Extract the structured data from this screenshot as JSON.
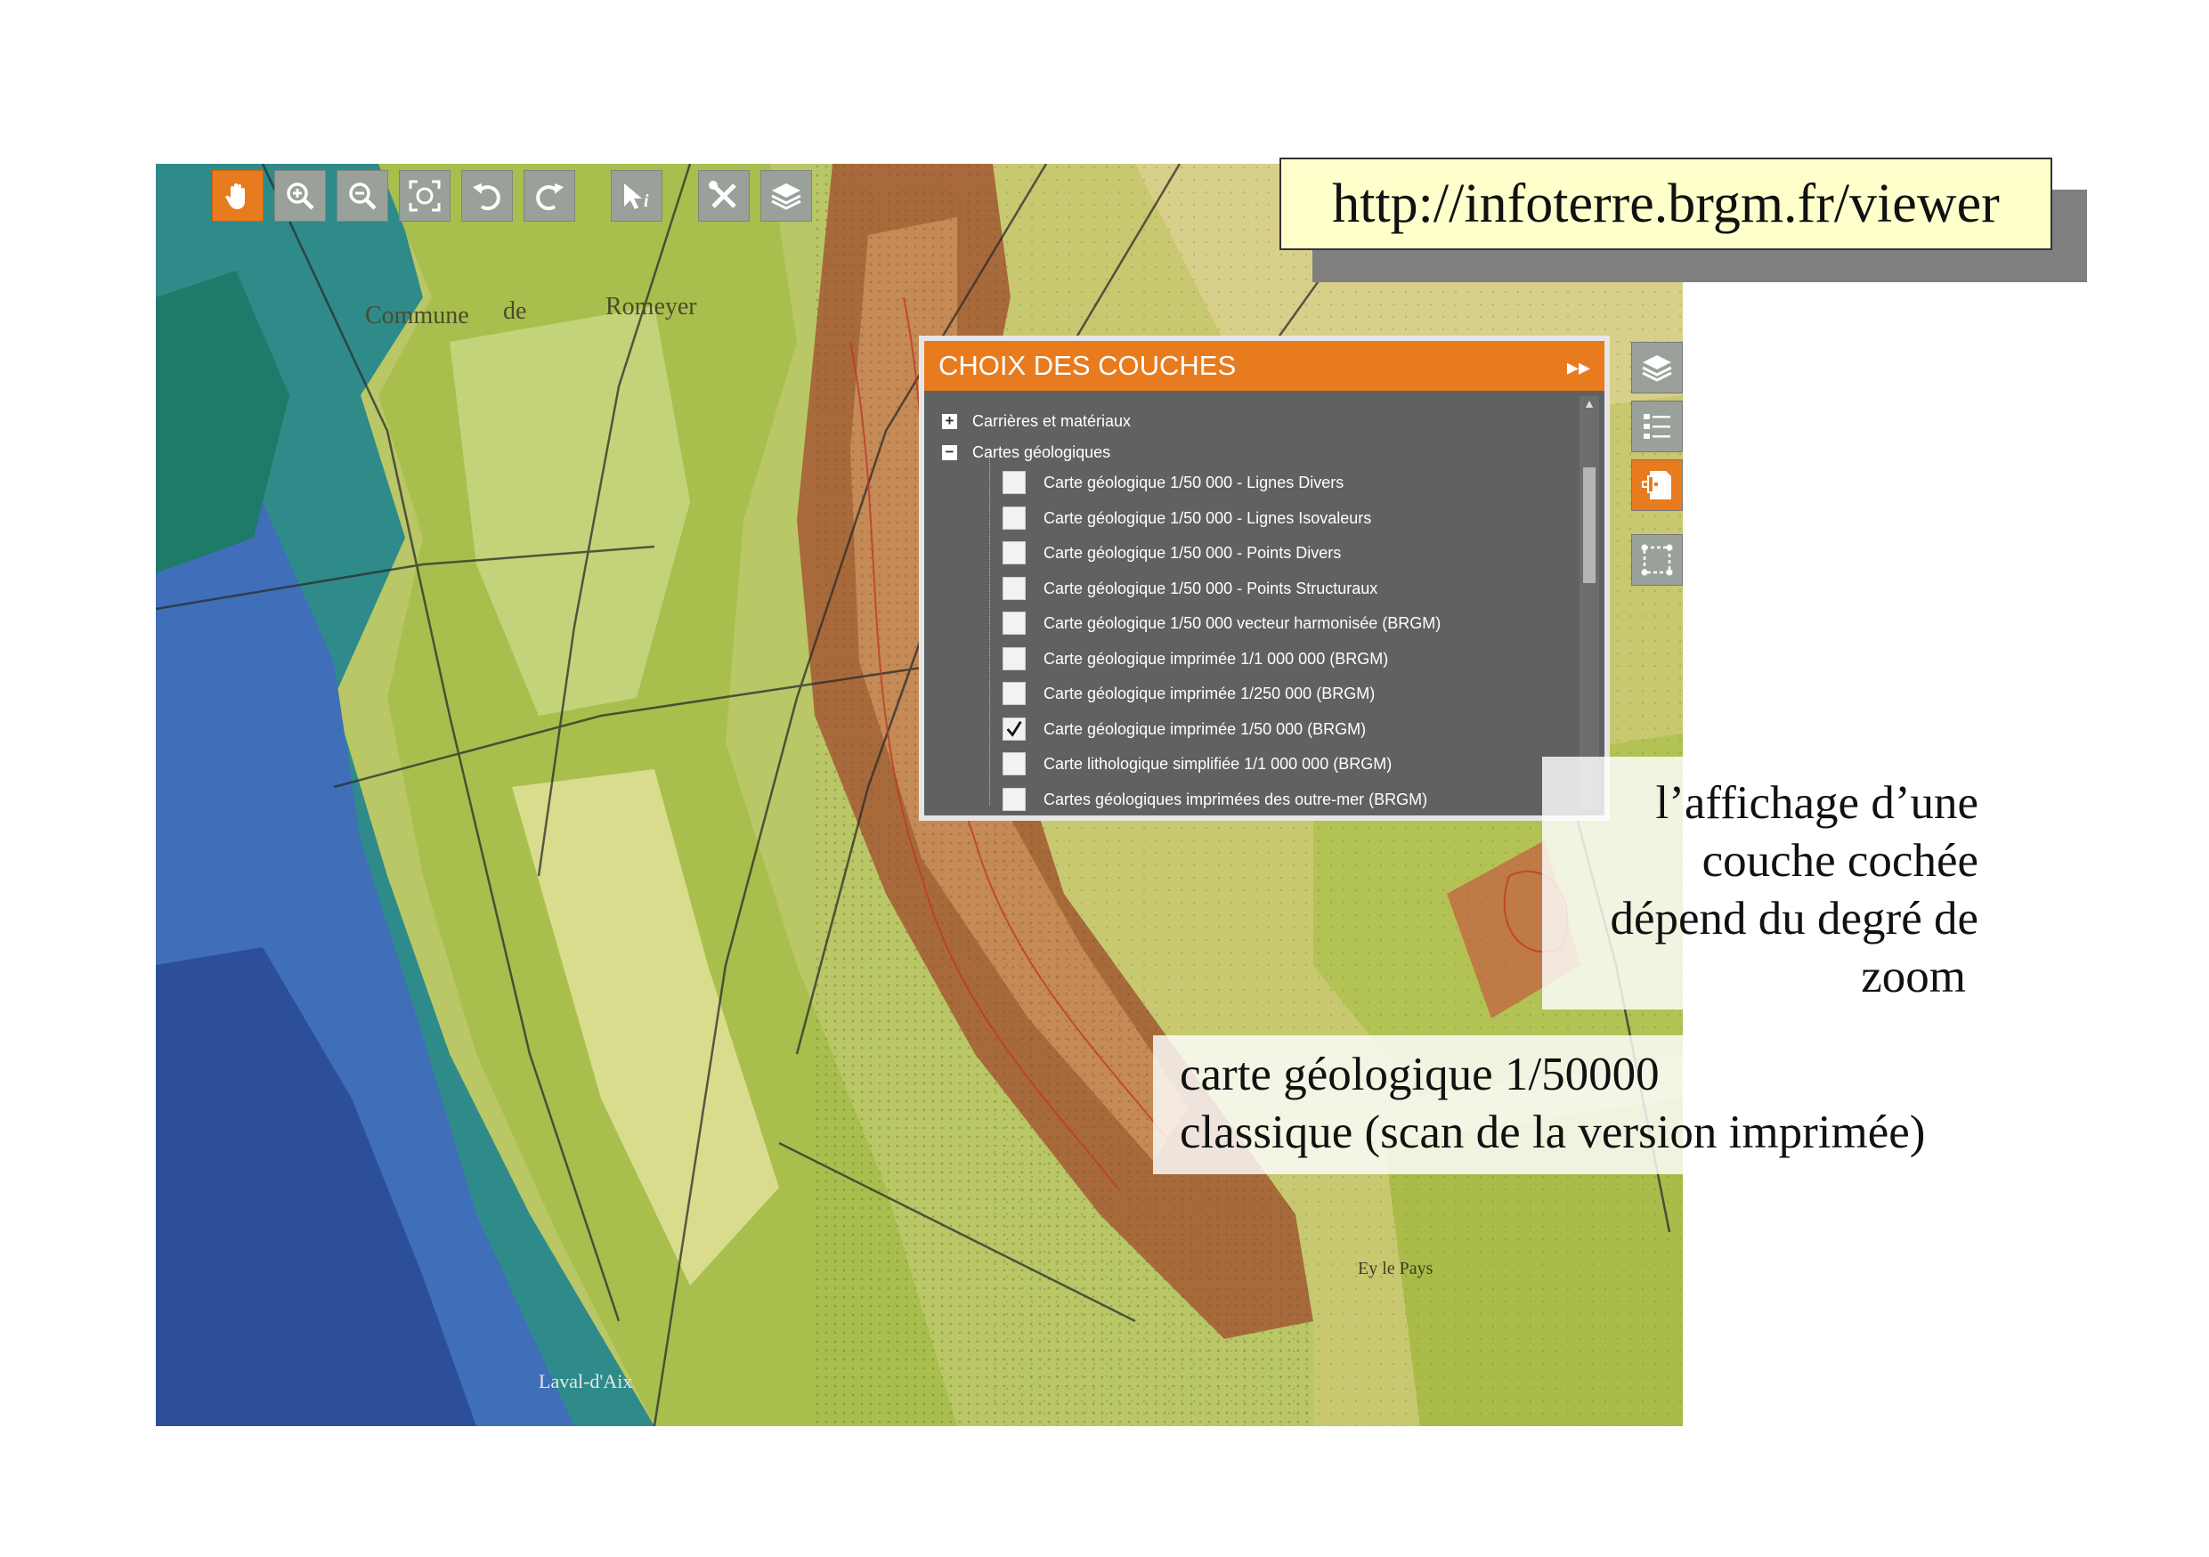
{
  "url": "http://infoterre.brgm.fr/viewer",
  "toolbar": {
    "tools": [
      {
        "icon": "pan-hand-icon",
        "active": true
      },
      {
        "icon": "zoom-in-icon"
      },
      {
        "icon": "zoom-out-icon"
      },
      {
        "icon": "zoom-extent-icon"
      },
      {
        "icon": "undo-icon"
      },
      {
        "icon": "redo-icon"
      },
      {
        "icon": "identify-info-icon"
      },
      {
        "icon": "tools-icon"
      },
      {
        "icon": "layers-icon"
      }
    ]
  },
  "side_tools": [
    {
      "icon": "layers-icon"
    },
    {
      "icon": "legend-list-icon"
    },
    {
      "icon": "add-layer-icon",
      "active": true
    },
    {
      "icon": "select-area-icon"
    }
  ],
  "panel": {
    "title": "CHOIX DES COUCHES",
    "collapse_glyph": "▸▸",
    "groups": [
      {
        "label": "Carrières et matériaux",
        "toggle": "+"
      },
      {
        "label": "Cartes géologiques",
        "toggle": "−"
      }
    ],
    "layers": [
      {
        "label": "Carte géologique 1/50 000 - Lignes Divers",
        "checked": false
      },
      {
        "label": "Carte géologique 1/50 000 - Lignes Isovaleurs",
        "checked": false
      },
      {
        "label": "Carte géologique 1/50 000 - Points Divers",
        "checked": false
      },
      {
        "label": "Carte géologique 1/50 000 - Points Structuraux",
        "checked": false
      },
      {
        "label": "Carte géologique 1/50 000 vecteur harmonisée (BRGM)",
        "checked": false
      },
      {
        "label": "Carte géologique imprimée 1/1 000 000 (BRGM)",
        "checked": false
      },
      {
        "label": "Carte géologique imprimée 1/250 000 (BRGM)",
        "checked": false
      },
      {
        "label": "Carte géologique imprimée 1/50 000 (BRGM)",
        "checked": true
      },
      {
        "label": "Carte lithologique simplifiée 1/1 000 000 (BRGM)",
        "checked": false
      },
      {
        "label": "Cartes géologiques imprimées des outre-mer (BRGM)",
        "checked": false
      }
    ]
  },
  "map_labels": {
    "commune": "Commune",
    "de": "de",
    "romeyer": "Romeyer",
    "laval": "Laval-d'Aix",
    "ey": "Ey le Pays"
  },
  "annotations": {
    "zoom_note": [
      "l’affichage d’une",
      "couche cochée",
      "dépend du degré de",
      "zoom"
    ],
    "carte_note": [
      "carte géologique 1/50000",
      "classique (scan de la version imprimée)"
    ]
  },
  "colors": {
    "accent": "#e87b1e",
    "panel_bg": "#5f6163",
    "url_bg": "#ffffcc"
  }
}
